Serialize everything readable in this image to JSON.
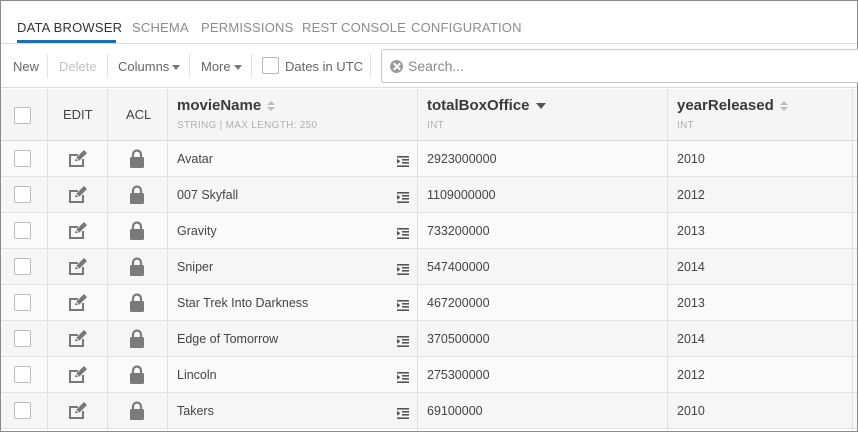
{
  "tabs": [
    {
      "label": "DATA BROWSER",
      "active": true
    },
    {
      "label": "SCHEMA",
      "active": false
    },
    {
      "label": "PERMISSIONS",
      "active": false
    },
    {
      "label": "REST CONSOLE",
      "active": false
    },
    {
      "label": "CONFIGURATION",
      "active": false
    }
  ],
  "toolbar": {
    "new_label": "New",
    "delete_label": "Delete",
    "columns_label": "Columns",
    "more_label": "More",
    "utc_label": "Dates in UTC",
    "utc_checked": false
  },
  "search": {
    "placeholder": "Search...",
    "value": ""
  },
  "grid": {
    "edit_header": "EDIT",
    "acl_header": "ACL",
    "columns": [
      {
        "name": "movieName",
        "type": "STRING | MAX LENGTH: 250",
        "sort": "none"
      },
      {
        "name": "totalBoxOffice",
        "type": "INT",
        "sort": "desc"
      },
      {
        "name": "yearReleased",
        "type": "INT",
        "sort": "none"
      }
    ],
    "rows": [
      {
        "movieName": "Avatar",
        "totalBoxOffice": "2923000000",
        "yearReleased": "2010"
      },
      {
        "movieName": "007 Skyfall",
        "totalBoxOffice": "1109000000",
        "yearReleased": "2012"
      },
      {
        "movieName": "Gravity",
        "totalBoxOffice": "733200000",
        "yearReleased": "2013"
      },
      {
        "movieName": "Sniper",
        "totalBoxOffice": "547400000",
        "yearReleased": "2014"
      },
      {
        "movieName": "Star Trek Into Darkness",
        "totalBoxOffice": "467200000",
        "yearReleased": "2013"
      },
      {
        "movieName": "Edge of Tomorrow",
        "totalBoxOffice": "370500000",
        "yearReleased": "2014"
      },
      {
        "movieName": "Lincoln",
        "totalBoxOffice": "275300000",
        "yearReleased": "2012"
      },
      {
        "movieName": "Takers",
        "totalBoxOffice": "69100000",
        "yearReleased": "2010"
      }
    ]
  },
  "icons": {
    "edit": "edit-icon",
    "lock": "lock-icon",
    "expand": "expand-text-icon",
    "search_clear": "clear-search-icon"
  },
  "colors": {
    "accent": "#1f6fb5",
    "header_bg": "#f5f5f5"
  }
}
